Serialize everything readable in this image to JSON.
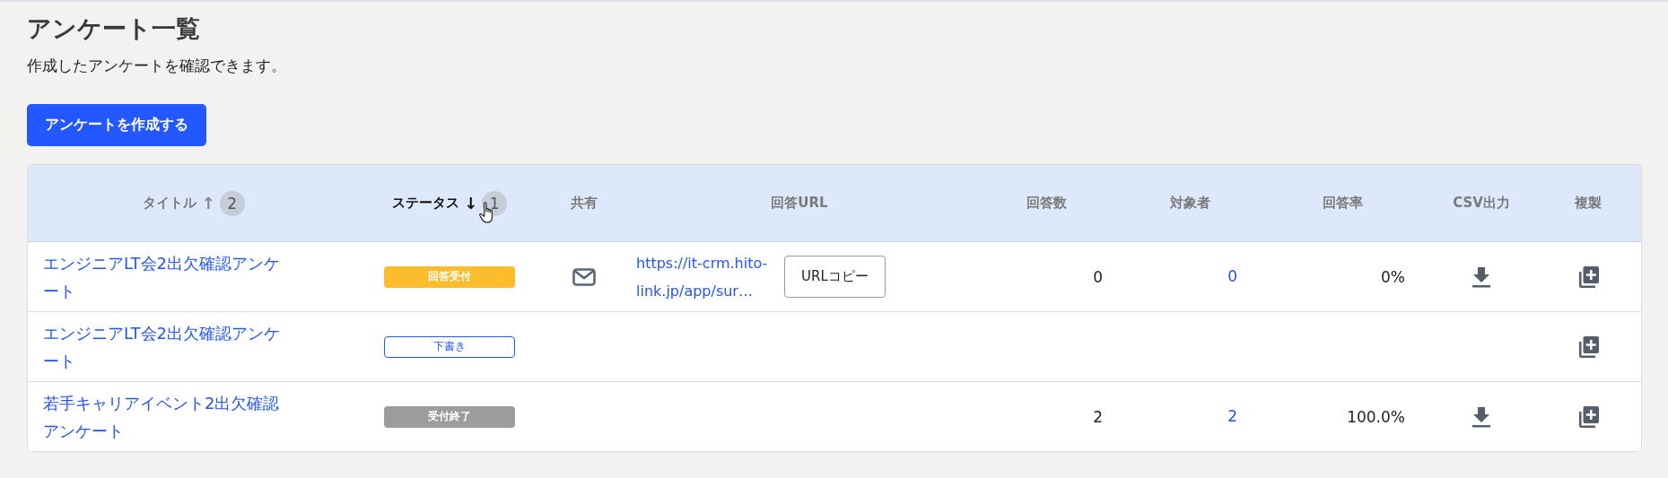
{
  "page": {
    "title": "アンケート一覧",
    "description": "作成したアンケートを確認できます。",
    "create_button": "アンケートを作成する"
  },
  "table": {
    "columns": [
      {
        "label": "タイトル",
        "active": false,
        "sort_arrow": "↑",
        "sort_rank": "2"
      },
      {
        "label": "ステータス",
        "active": true,
        "sort_arrow": "↓",
        "sort_rank": "1"
      },
      {
        "label": "共有",
        "active": false
      },
      {
        "label": "回答URL",
        "active": false
      },
      {
        "label": "回答数",
        "active": false
      },
      {
        "label": "対象者",
        "active": false
      },
      {
        "label": "回答率",
        "active": false
      },
      {
        "label": "CSV出力",
        "active": false
      },
      {
        "label": "複製",
        "active": false
      }
    ],
    "rows": [
      {
        "title": "エンジニアLT会2出欠確認アンケート",
        "status": {
          "label": "回答受付",
          "kind": "open"
        },
        "shareable": true,
        "url": "https://it-crm.hito-link.jp/app/sur…",
        "copy_button": "URLコピー",
        "responses": "0",
        "targets": "0",
        "rate": "0%",
        "csv": true,
        "duplicate": true
      },
      {
        "title": "エンジニアLT会2出欠確認アンケート",
        "status": {
          "label": "下書き",
          "kind": "draft"
        },
        "shareable": false,
        "csv": false,
        "duplicate": true
      },
      {
        "title": "若手キャリアイベント2出欠確認アンケート",
        "status": {
          "label": "受付終了",
          "kind": "closed"
        },
        "shareable": false,
        "responses": "2",
        "targets": "2",
        "rate": "100.0%",
        "csv": true,
        "duplicate": true
      }
    ]
  }
}
